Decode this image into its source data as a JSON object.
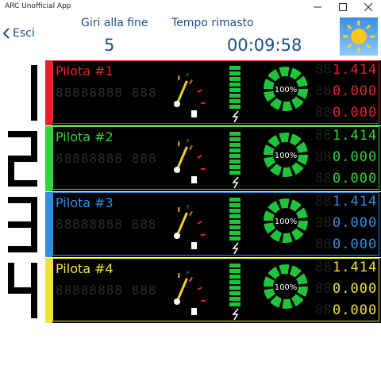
{
  "window": {
    "title": "ARC Unofficial App"
  },
  "header": {
    "back_label": "Esci",
    "laps_label": "Giri alla fine",
    "laps_value": "5",
    "time_label": "Tempo rimasto",
    "time_value": "00:09:58"
  },
  "pilots": [
    {
      "number": "1",
      "name": "Pilota #1",
      "color": "#e8202a",
      "fuel_percent": "100%",
      "row1": "1.414",
      "row2": "0.000",
      "row3": "0.000"
    },
    {
      "number": "2",
      "name": "Pilota #2",
      "color": "#33d43a",
      "fuel_percent": "100%",
      "row1": "1.414",
      "row2": "0.000",
      "row3": "0.000"
    },
    {
      "number": "3",
      "name": "Pilota #3",
      "color": "#2f8fe0",
      "fuel_percent": "100%",
      "row1": "1.414",
      "row2": "0.000",
      "row3": "0.000"
    },
    {
      "number": "4",
      "name": "Pilota #4",
      "color": "#f2e23a",
      "fuel_percent": "100%",
      "row1": "1.414",
      "row2": "0.000",
      "row3": "0.000"
    }
  ],
  "colors": {
    "header_text": "#1a4f8a",
    "energy_bar": "#1fc43a"
  }
}
